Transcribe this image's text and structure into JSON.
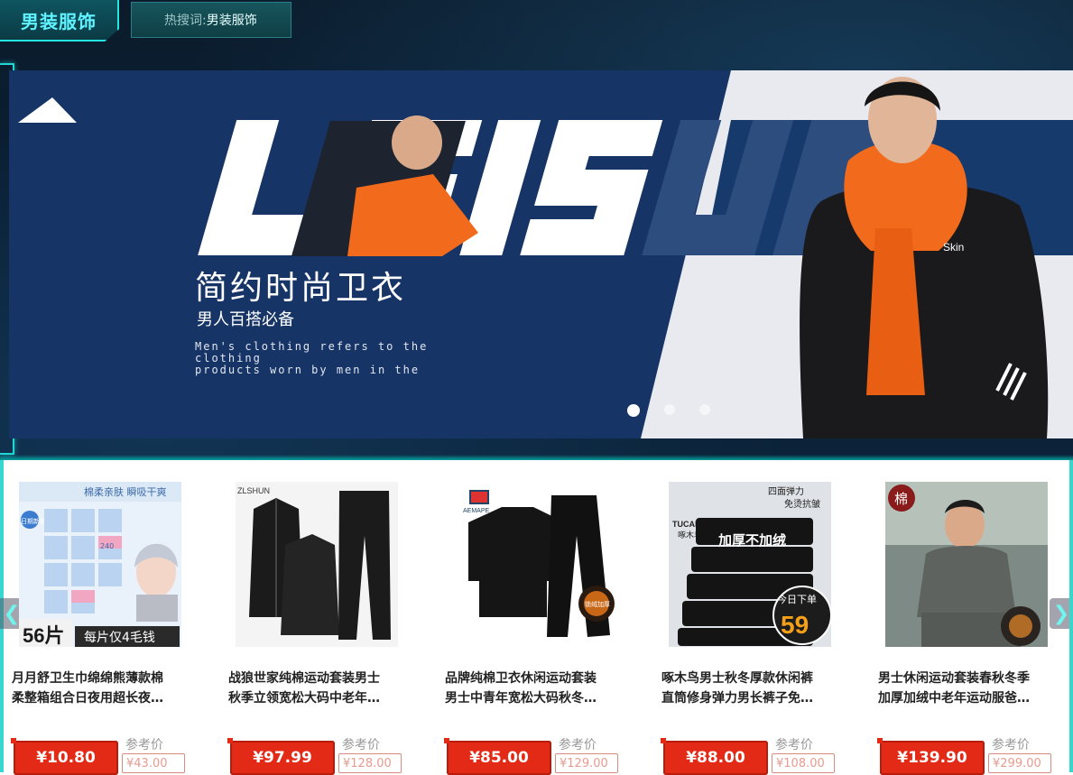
{
  "header": {
    "category": "男装服饰",
    "hot_search_label": "热搜词:",
    "hot_search_keyword": "男装服饰"
  },
  "banner": {
    "big_word": "LEISURE",
    "title": "简约时尚卫衣",
    "subtitle": "男人百搭必备",
    "english_line1": "Men's clothing refers to the clothing",
    "english_line2": "products worn by men in the",
    "jacket_text": "Skin",
    "slides": 3,
    "active_slide": 1
  },
  "nav": {
    "prev_icon": "chevron-left-icon",
    "next_icon": "chevron-right-icon"
  },
  "products": [
    {
      "title_line1": "月月舒卫生巾绵绵熊薄款棉",
      "title_line2": "柔整箱组合日夜用超长夜…",
      "price": "¥10.80",
      "ref_label": "参考价",
      "ref_price": "¥43.00",
      "thumb": {
        "top_text": "棉柔亲肤 瞬吸干爽",
        "badge_text": "日期新鲜",
        "count": "56片",
        "promo": "每片仅4毛钱",
        "pack_label": "240"
      }
    },
    {
      "title_line1": "战狼世家纯棉运动套装男士",
      "title_line2": "秋季立领宽松大码中老年…",
      "price": "¥97.99",
      "ref_label": "参考价",
      "ref_price": "¥128.00",
      "thumb": {
        "brand": "ZLSHUN"
      }
    },
    {
      "title_line1": "品牌纯棉卫衣休闲运动套装",
      "title_line2": "男士中青年宽松大码秋冬…",
      "price": "¥85.00",
      "ref_label": "参考价",
      "ref_price": "¥129.00",
      "thumb": {
        "brand": "AEMAPE",
        "badge": "锁绒加厚"
      }
    },
    {
      "title_line1": "啄木鸟男士秋冬厚款休闲裤",
      "title_line2": "直筒修身弹力男长裤子免…",
      "price": "¥88.00",
      "ref_label": "参考价",
      "ref_price": "¥108.00",
      "thumb": {
        "brand": "TUCANO",
        "brand_cn": "啄木鸟",
        "tag1": "四面弹力",
        "tag2": "免烫抗皱",
        "slogan": "加厚不加绒",
        "order_label": "今日下单",
        "order_price": "59"
      }
    },
    {
      "title_line1": "男士休闲运动套装春秋冬季",
      "title_line2": "加厚加绒中老年运动服爸…",
      "price": "¥139.90",
      "ref_label": "参考价",
      "ref_price": "¥299.00",
      "thumb": {
        "corner": "棉"
      }
    }
  ],
  "colors": {
    "accent_cyan": "#22e6e0",
    "banner_navy": "#163566",
    "price_red": "#e32a17",
    "ref_text": "#e89b8f",
    "hoodie_orange": "#f26a1b"
  }
}
